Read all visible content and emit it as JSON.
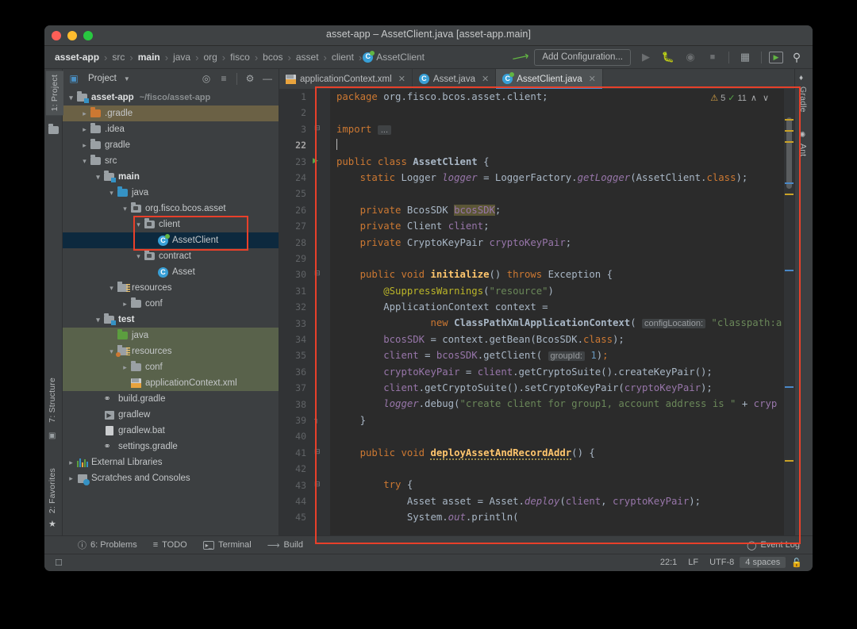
{
  "window": {
    "title": "asset-app – AssetClient.java [asset-app.main]",
    "traffic": [
      "close",
      "minimize",
      "zoom"
    ]
  },
  "navbar": {
    "crumbs": [
      {
        "label": "asset-app",
        "bold": true
      },
      {
        "label": "src",
        "bold": false
      },
      {
        "label": "main",
        "bold": true
      },
      {
        "label": "java",
        "bold": false
      },
      {
        "label": "org",
        "bold": false
      },
      {
        "label": "fisco",
        "bold": false
      },
      {
        "label": "bcos",
        "bold": false
      },
      {
        "label": "asset",
        "bold": false
      },
      {
        "label": "client",
        "bold": false
      },
      {
        "label": "AssetClient",
        "bold": false,
        "icon": "java-class-icon"
      }
    ],
    "separator": "›",
    "add_configuration": "Add Configuration...",
    "buttons": [
      "build-hammer-icon",
      "run-icon",
      "debug-icon",
      "run-coverage-icon",
      "stop-icon",
      "project-structure-icon",
      "console-icon",
      "search-everywhere-icon"
    ]
  },
  "left_rail": {
    "tabs": [
      "1: Project",
      "7: Structure",
      "2: Favorites"
    ],
    "selected": "1: Project"
  },
  "right_rail": {
    "tabs": [
      "Gradle",
      "Ant"
    ]
  },
  "project_panel": {
    "title": "Project",
    "toolbar_icons": [
      "locate-icon",
      "collapse-all-icon",
      "settings-gear-icon",
      "hide-icon"
    ],
    "tree": [
      {
        "depth": 0,
        "arrow": "v",
        "icon": "module-folder-icon",
        "label": "asset-app",
        "sub": "~/fisco/asset-app",
        "bold": true,
        "style": "none"
      },
      {
        "depth": 1,
        "arrow": ">",
        "icon": "folder-orange-icon",
        "label": ".gradle",
        "style": "excluded"
      },
      {
        "depth": 1,
        "arrow": ">",
        "icon": "folder-icon",
        "label": ".idea",
        "style": "none"
      },
      {
        "depth": 1,
        "arrow": ">",
        "icon": "folder-icon",
        "label": "gradle",
        "style": "none"
      },
      {
        "depth": 1,
        "arrow": "v",
        "icon": "folder-icon",
        "label": "src",
        "style": "none"
      },
      {
        "depth": 2,
        "arrow": "v",
        "icon": "source-root-icon",
        "label": "main",
        "bold": true,
        "style": "none"
      },
      {
        "depth": 3,
        "arrow": "v",
        "icon": "folder-blue-icon",
        "label": "java",
        "style": "none"
      },
      {
        "depth": 4,
        "arrow": "v",
        "icon": "package-icon",
        "label": "org.fisco.bcos.asset",
        "style": "none"
      },
      {
        "depth": 5,
        "arrow": "v",
        "icon": "package-icon",
        "label": "client",
        "style": "none"
      },
      {
        "depth": 6,
        "arrow": "",
        "icon": "java-class-icon",
        "label": "AssetClient",
        "style": "selected"
      },
      {
        "depth": 5,
        "arrow": "v",
        "icon": "package-icon",
        "label": "contract",
        "style": "none"
      },
      {
        "depth": 6,
        "arrow": "",
        "icon": "java-class-plain-icon",
        "label": "Asset",
        "style": "none"
      },
      {
        "depth": 3,
        "arrow": "v",
        "icon": "resources-root-icon",
        "label": "resources",
        "style": "none"
      },
      {
        "depth": 4,
        "arrow": ">",
        "icon": "folder-icon",
        "label": "conf",
        "style": "none"
      },
      {
        "depth": 2,
        "arrow": "v",
        "icon": "source-root-icon",
        "label": "test",
        "bold": true,
        "style": "none"
      },
      {
        "depth": 3,
        "arrow": "",
        "icon": "folder-green-icon",
        "label": "java",
        "style": "green"
      },
      {
        "depth": 3,
        "arrow": "v",
        "icon": "test-resources-root-icon",
        "label": "resources",
        "style": "green"
      },
      {
        "depth": 4,
        "arrow": ">",
        "icon": "folder-icon",
        "label": "conf",
        "style": "green"
      },
      {
        "depth": 4,
        "arrow": "",
        "icon": "xml-file-icon",
        "label": "applicationContext.xml",
        "style": "green"
      },
      {
        "depth": 2,
        "arrow": "",
        "icon": "gradle-file-icon",
        "label": "build.gradle",
        "style": "none"
      },
      {
        "depth": 2,
        "arrow": "",
        "icon": "script-file-icon",
        "label": "gradlew",
        "style": "none"
      },
      {
        "depth": 2,
        "arrow": "",
        "icon": "bat-file-icon",
        "label": "gradlew.bat",
        "style": "none"
      },
      {
        "depth": 2,
        "arrow": "",
        "icon": "gradle-file-icon",
        "label": "settings.gradle",
        "style": "none"
      },
      {
        "depth": 0,
        "arrow": ">",
        "icon": "external-libraries-icon",
        "label": "External Libraries",
        "style": "none"
      },
      {
        "depth": 0,
        "arrow": ">",
        "icon": "scratches-icon",
        "label": "Scratches and Consoles",
        "style": "none"
      }
    ]
  },
  "editor": {
    "tabs": [
      {
        "label": "applicationContext.xml",
        "icon": "xml-file-icon",
        "active": false
      },
      {
        "label": "Asset.java",
        "icon": "java-class-plain-icon",
        "active": false
      },
      {
        "label": "AssetClient.java",
        "icon": "java-class-icon",
        "active": true
      }
    ],
    "inspection": {
      "warning_count": "5",
      "check_count": "11",
      "up": "∧",
      "down": "∨"
    },
    "line_numbers": [
      "1",
      "2",
      "3",
      "22",
      "23",
      "24",
      "25",
      "26",
      "27",
      "28",
      "29",
      "30",
      "31",
      "32",
      "33",
      "34",
      "35",
      "36",
      "37",
      "38",
      "39",
      "40",
      "41",
      "42",
      "43",
      "44",
      "45"
    ],
    "current_line": "22",
    "lines": [
      "package org.fisco.bcos.asset.client;",
      "",
      "import ...",
      "",
      "public class AssetClient {",
      "    static Logger logger = LoggerFactory.getLogger(AssetClient.class);",
      "",
      "    private BcosSDK bcosSDK;",
      "    private Client client;",
      "    private CryptoKeyPair cryptoKeyPair;",
      "",
      "    public void initialize() throws Exception {",
      "        @SuppressWarnings(\"resource\")",
      "        ApplicationContext context =",
      "                new ClassPathXmlApplicationContext( configLocation: \"classpath:a",
      "        bcosSDK = context.getBean(BcosSDK.class);",
      "        client = bcosSDK.getClient( groupId: 1);",
      "        cryptoKeyPair = client.getCryptoSuite().createKeyPair();",
      "        client.getCryptoSuite().setCryptoKeyPair(cryptoKeyPair);",
      "        logger.debug(\"create client for group1, account address is \" + cryp",
      "    }",
      "",
      "    public void deployAssetAndRecordAddr() {",
      "",
      "        try {",
      "            Asset asset = Asset.deploy(client, cryptoKeyPair);",
      "            System.out.println("
    ],
    "param_hints": [
      "configLocation:",
      "groupId:"
    ]
  },
  "bottom_bar": {
    "items": [
      {
        "label": "6: Problems",
        "icon": "problems-icon",
        "underline": "6"
      },
      {
        "label": "TODO",
        "icon": "todo-icon"
      },
      {
        "label": "Terminal",
        "icon": "terminal-icon"
      },
      {
        "label": "Build",
        "icon": "build-hammer-icon"
      }
    ],
    "event_log": {
      "label": "Event Log",
      "icon": "event-log-icon"
    }
  },
  "status_bar": {
    "position": "22:1",
    "line_separator": "LF",
    "encoding": "UTF-8",
    "indent": "4 spaces",
    "lock_icon": "unlocked-icon"
  },
  "colors": {
    "accent_red_box": "#e8402a",
    "selection_blue": "#0d293e",
    "green_source": "#59624b",
    "excluded_gold": "#6b6145"
  }
}
